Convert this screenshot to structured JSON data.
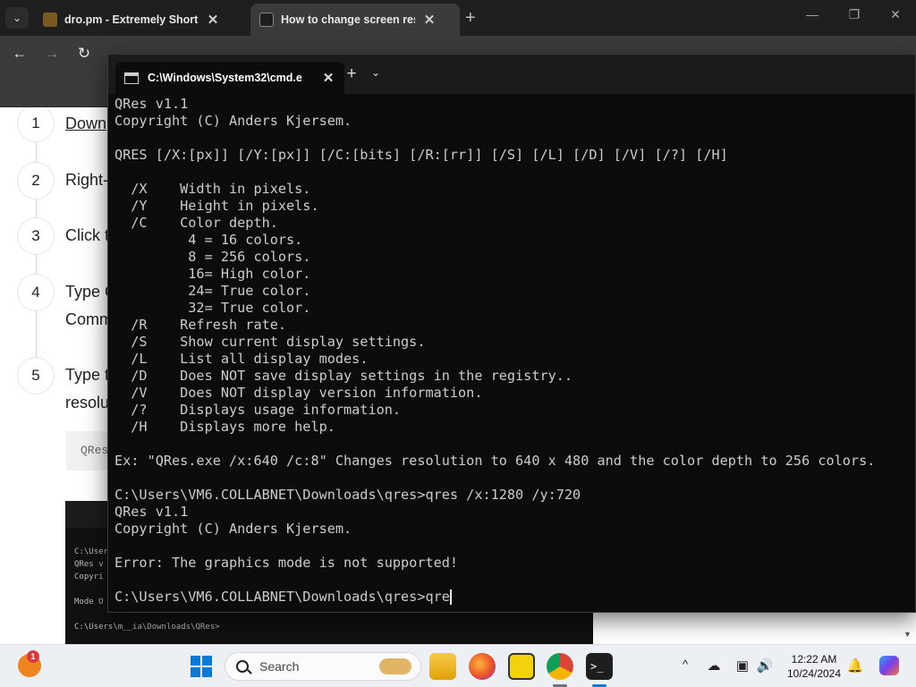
{
  "browser": {
    "tabs": [
      {
        "title": "dro.pm - Extremely Short Link",
        "close": "✕"
      },
      {
        "title": "How to change screen resolution",
        "close": "✕"
      }
    ],
    "new_tab": "+",
    "window_controls": {
      "minimize": "—",
      "maximize": "❐",
      "close": "✕"
    },
    "nav": {
      "back": "←",
      "forward": "→",
      "reload": "↻"
    }
  },
  "page": {
    "steps": [
      {
        "number": "1",
        "text": "Down"
      },
      {
        "number": "2",
        "text": "Right-"
      },
      {
        "number": "3",
        "text": "Click t"
      },
      {
        "number": "4",
        "text": "Type C",
        "text2": "Comm"
      },
      {
        "number": "5",
        "text": "Type t",
        "text2": "resolu"
      }
    ],
    "code_snippet": "QRes",
    "embedded_screenshot": {
      "lines": [
        "C:\\Users\\",
        "QRes v",
        "Copyri",
        "Mode O",
        "C:\\Users\\m__ia\\Downloads\\QRes>"
      ]
    }
  },
  "terminal": {
    "tab_title": "C:\\Windows\\System32\\cmd.e",
    "tab_close": "✕",
    "new_tab": "+",
    "dropdown": "⌄",
    "lines": [
      "QRes v1.1",
      "Copyright (C) Anders Kjersem.",
      "",
      "QRES [/X:[px]] [/Y:[px]] [/C:[bits] [/R:[rr]] [/S] [/L] [/D] [/V] [/?] [/H]",
      "",
      "  /X    Width in pixels.",
      "  /Y    Height in pixels.",
      "  /C    Color depth.",
      "         4 = 16 colors.",
      "         8 = 256 colors.",
      "         16= High color.",
      "         24= True color.",
      "         32= True color.",
      "  /R    Refresh rate.",
      "  /S    Show current display settings.",
      "  /L    List all display modes.",
      "  /D    Does NOT save display settings in the registry..",
      "  /V    Does NOT display version information.",
      "  /?    Displays usage information.",
      "  /H    Displays more help.",
      "",
      "Ex: \"QRes.exe /x:640 /c:8\" Changes resolution to 640 x 480 and the color depth to 256 colors.",
      "",
      "C:\\Users\\VM6.COLLABNET\\Downloads\\qres>qres /x:1280 /y:720",
      "QRes v1.1",
      "Copyright (C) Anders Kjersem.",
      "",
      "Error: The graphics mode is not supported!",
      ""
    ],
    "prompt": "C:\\Users\\VM6.COLLABNET\\Downloads\\qres>",
    "current_input": "qre"
  },
  "taskbar": {
    "weather_badge": "1",
    "search_label": "Search",
    "apps": [
      "file-explorer",
      "firefox",
      "paint",
      "chrome",
      "terminal"
    ],
    "tray": {
      "chevron": "^",
      "network": "☁",
      "display": "▣",
      "volume": "🔊",
      "bell": "🔔"
    },
    "time": "12:22 AM",
    "date": "10/24/2024"
  },
  "colors": {
    "terminal_bg": "#0c0c0c",
    "terminal_text": "#cccccc",
    "browser_dark": "#3b3b3b",
    "taskbar_bg": "#eceff4",
    "windows_blue": "#0a7ad8"
  }
}
